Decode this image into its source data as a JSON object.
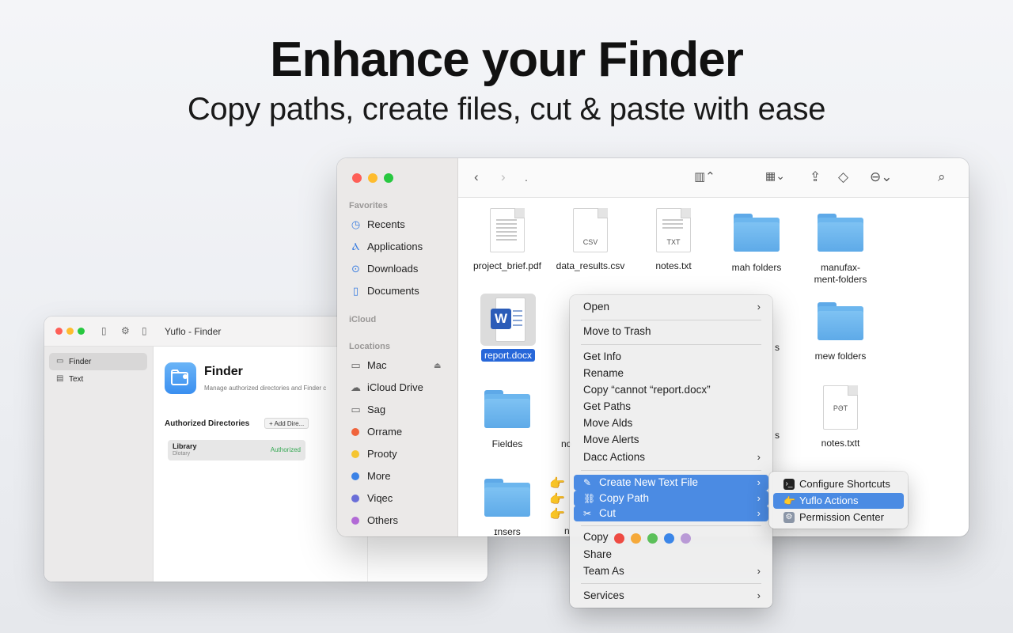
{
  "hero": {
    "title": "Enhance your Finder",
    "subtitle": "Copy paths, create files, cut & paste with ease"
  },
  "yuflo_window": {
    "title": "Yuflo - Finder",
    "sidebar": [
      {
        "label": "Finder",
        "icon": "finder-icon",
        "selected": true
      },
      {
        "label": "Text",
        "icon": "doc-icon",
        "selected": false
      }
    ],
    "app_title": "Finder",
    "app_description": "Manage authorized directories and Finder c",
    "authorized_header": "Authorized Directories",
    "add_button": "+ Add Dire...",
    "directories": [
      {
        "name": "Library",
        "sub": "Dlotary",
        "status": "Authorized"
      }
    ]
  },
  "finder_window": {
    "path_label": ".",
    "sidebar": {
      "favorites_header": "Favorites",
      "favorites": [
        {
          "label": "Recents",
          "icon": "clock-icon"
        },
        {
          "label": "Applications",
          "icon": "applications-icon"
        },
        {
          "label": "Downloads",
          "icon": "download-icon"
        },
        {
          "label": "Documents",
          "icon": "document-icon"
        }
      ],
      "icloud_header": "iCloud",
      "locations_header": "Locations",
      "locations": [
        {
          "label": "Mac",
          "icon": "laptop-icon"
        },
        {
          "label": "iCloud Drive",
          "icon": "cloud-icon"
        },
        {
          "label": "Sag",
          "icon": "folder-icon"
        }
      ],
      "tags": [
        {
          "label": "Orrame",
          "color": "#f0643c"
        },
        {
          "label": "Prooty",
          "color": "#f5c531"
        },
        {
          "label": "More",
          "color": "#3b82e6"
        },
        {
          "label": "Viqec",
          "color": "#6a6ed8"
        },
        {
          "label": "Others",
          "color": "#b26ad6"
        }
      ]
    },
    "files": [
      {
        "name": "project_brief.pdf",
        "kind": "doc",
        "ext": ""
      },
      {
        "name": "data_results.csv",
        "kind": "doc",
        "ext": "CSV"
      },
      {
        "name": "notes.txt",
        "kind": "doc",
        "ext": "TXT"
      },
      {
        "name": "mah folders",
        "kind": "folder"
      },
      {
        "name": "manufax-ment-folders",
        "kind": "folder"
      },
      {
        "name": "report.docx",
        "kind": "word",
        "selected": true
      },
      {
        "name": "mew folders",
        "kind": "folder"
      },
      {
        "name": "Fieldes",
        "kind": "folder"
      },
      {
        "name": "notes.txtt",
        "kind": "doc",
        "ext": "PƏT"
      },
      {
        "name": "ɪnsers",
        "kind": "folder"
      },
      {
        "name": "s",
        "kind": "partial"
      },
      {
        "name": "s",
        "kind": "partial"
      },
      {
        "name": "no",
        "kind": "partial"
      },
      {
        "name": "n",
        "kind": "partial"
      }
    ]
  },
  "context_menu": {
    "open": "Open",
    "move_to_trash": "Move to Trash",
    "get_info": "Get Info",
    "rename": "Rename",
    "copy_named": "Copy “cannot “report.docx”",
    "get_paths": "Get Paths",
    "move_alds": "Move Alds",
    "move_alerts": "Move Alerts",
    "dacc_actions": "Dacc Actions",
    "create_new_text_file": "Create New Text File",
    "copy_path": "Copy Path",
    "cut": "Cut",
    "copy": "Copy",
    "share": "Share",
    "team_as": "Team As",
    "services": "Services",
    "tag_colors": [
      "#ee4b43",
      "#f5a93a",
      "#5cc05a",
      "#3b86e8",
      "#b99ad6"
    ]
  },
  "submenu": {
    "items": [
      {
        "label": "Configure Shortcuts",
        "icon": "terminal-icon",
        "highlighted": false
      },
      {
        "label": "Yuflo Actions",
        "icon": "pointing-hand-icon",
        "highlighted": true
      },
      {
        "label": "Permission Center",
        "icon": "gear-badge-icon",
        "highlighted": false
      }
    ]
  }
}
